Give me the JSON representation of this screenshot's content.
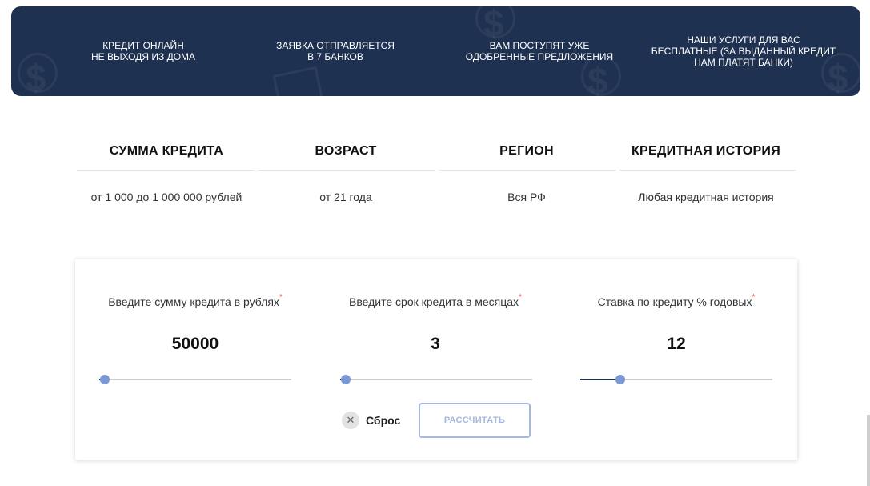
{
  "banner": {
    "items": [
      {
        "line1": "КРЕДИТ ОНЛАЙН",
        "line2": "НЕ ВЫХОДЯ ИЗ ДОМА",
        "line3": ""
      },
      {
        "line1": "ЗАЯВКА ОТПРАВЛЯЕТСЯ",
        "line2": "В 7 БАНКОВ",
        "line3": ""
      },
      {
        "line1": "ВАМ ПОСТУПЯТ УЖЕ",
        "line2": "ОДОБРЕННЫЕ ПРЕДЛОЖЕНИЯ",
        "line3": ""
      },
      {
        "line1": "НАШИ УСЛУГИ ДЛЯ ВАС",
        "line2": "БЕСПЛАТНЫЕ (ЗА ВЫДАННЫЙ КРЕДИТ",
        "line3": "НАМ ПЛАТЯТ БАНКИ)"
      }
    ]
  },
  "params": {
    "amount": {
      "title": "СУММА КРЕДИТА",
      "value": "от 1 000 до 1 000 000 рублей"
    },
    "age": {
      "title": "ВОЗРАСТ",
      "value": "от 21 года"
    },
    "region": {
      "title": "РЕГИОН",
      "value": "Вся РФ"
    },
    "history": {
      "title": "КРЕДИТНАЯ ИСТОРИЯ",
      "value": "Любая кредитная история"
    }
  },
  "calculator": {
    "required_mark": "*",
    "amount": {
      "label": "Введите сумму кредита в рублях",
      "value": "50000",
      "slider_fraction": 0.03
    },
    "term": {
      "label": "Введите срок кредита в месяцах",
      "value": "3",
      "slider_fraction": 0.03
    },
    "rate": {
      "label": "Ставка по кредиту % годовых",
      "value": "12",
      "slider_fraction": 0.21
    },
    "reset_label": "Сброс",
    "calculate_label": "РАССЧИТАТЬ"
  },
  "colors": {
    "banner_bg": "#1e3150",
    "slider_thumb": "#7a97d6",
    "button_border": "#a5b8e0",
    "required": "#e53935"
  },
  "icons": {
    "reset": "close-icon",
    "banner_decoration": "dollar-coin-icon"
  }
}
